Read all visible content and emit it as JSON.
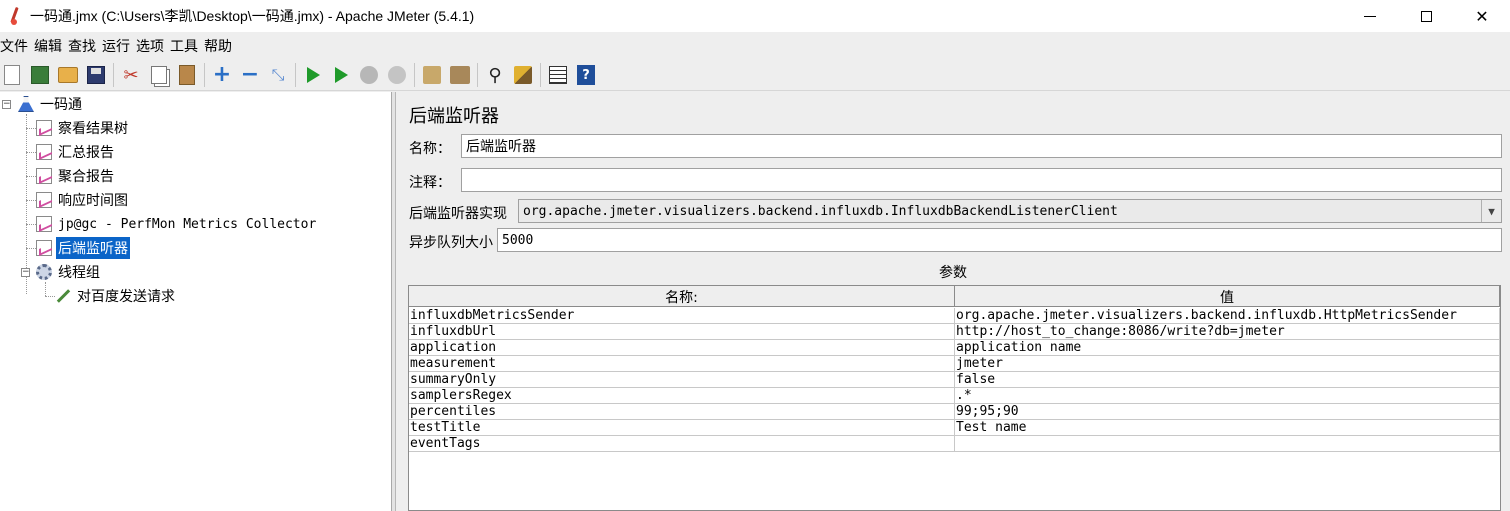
{
  "window": {
    "title": "一码通.jmx (C:\\Users\\李凯\\Desktop\\一码通.jmx) - Apache JMeter (5.4.1)"
  },
  "menubar": {
    "items": [
      "文件",
      "编辑",
      "查找",
      "运行",
      "选项",
      "工具",
      "帮助"
    ]
  },
  "toolbar": {
    "buttons": [
      {
        "icon": "new-document-icon"
      },
      {
        "icon": "templates-icon"
      },
      {
        "icon": "open-folder-icon"
      },
      {
        "icon": "save-icon"
      },
      {
        "icon": "cut-icon"
      },
      {
        "icon": "copy-icon"
      },
      {
        "icon": "paste-icon"
      },
      {
        "icon": "expand-all-icon"
      },
      {
        "icon": "collapse-all-icon"
      },
      {
        "icon": "toggle-icon"
      },
      {
        "icon": "start-icon"
      },
      {
        "icon": "start-no-timers-icon"
      },
      {
        "icon": "stop-icon"
      },
      {
        "icon": "shutdown-icon"
      },
      {
        "icon": "clear-icon"
      },
      {
        "icon": "clear-all-icon"
      },
      {
        "icon": "search-icon"
      },
      {
        "icon": "reset-search-icon"
      },
      {
        "icon": "function-helper-icon"
      },
      {
        "icon": "help-icon"
      }
    ]
  },
  "tree": {
    "root": "一码通",
    "children": [
      "察看结果树",
      "汇总报告",
      "聚合报告",
      "响应时间图",
      "jp@gc - PerfMon Metrics Collector",
      "后端监听器"
    ],
    "thread_group": "线程组",
    "sampler": "对百度发送请求",
    "selected": "后端监听器"
  },
  "panel": {
    "title": "后端监听器",
    "name_label": "名称：",
    "name_value": "后端监听器",
    "comment_label": "注释：",
    "comment_value": "",
    "impl_label": "后端监听器实现",
    "impl_value": "org.apache.jmeter.visualizers.backend.influxdb.InfluxdbBackendListenerClient",
    "queue_label": "异步队列大小",
    "queue_value": "5000",
    "params_title": "参数",
    "params_header": {
      "name": "名称:",
      "value": "值"
    },
    "params": [
      {
        "name": "influxdbMetricsSender",
        "value": "org.apache.jmeter.visualizers.backend.influxdb.HttpMetricsSender"
      },
      {
        "name": "influxdbUrl",
        "value": "http://host_to_change:8086/write?db=jmeter"
      },
      {
        "name": "application",
        "value": "application name"
      },
      {
        "name": "measurement",
        "value": "jmeter"
      },
      {
        "name": "summaryOnly",
        "value": "false"
      },
      {
        "name": "samplersRegex",
        "value": ".*"
      },
      {
        "name": "percentiles",
        "value": "99;95;90"
      },
      {
        "name": "testTitle",
        "value": "Test name"
      },
      {
        "name": "eventTags",
        "value": ""
      }
    ]
  },
  "colors": {
    "selection": "#0a64c8",
    "panel_bg": "#eeeeee",
    "start_green": "#1f9a2a",
    "toolbar_blue": "#2a6fc6"
  }
}
